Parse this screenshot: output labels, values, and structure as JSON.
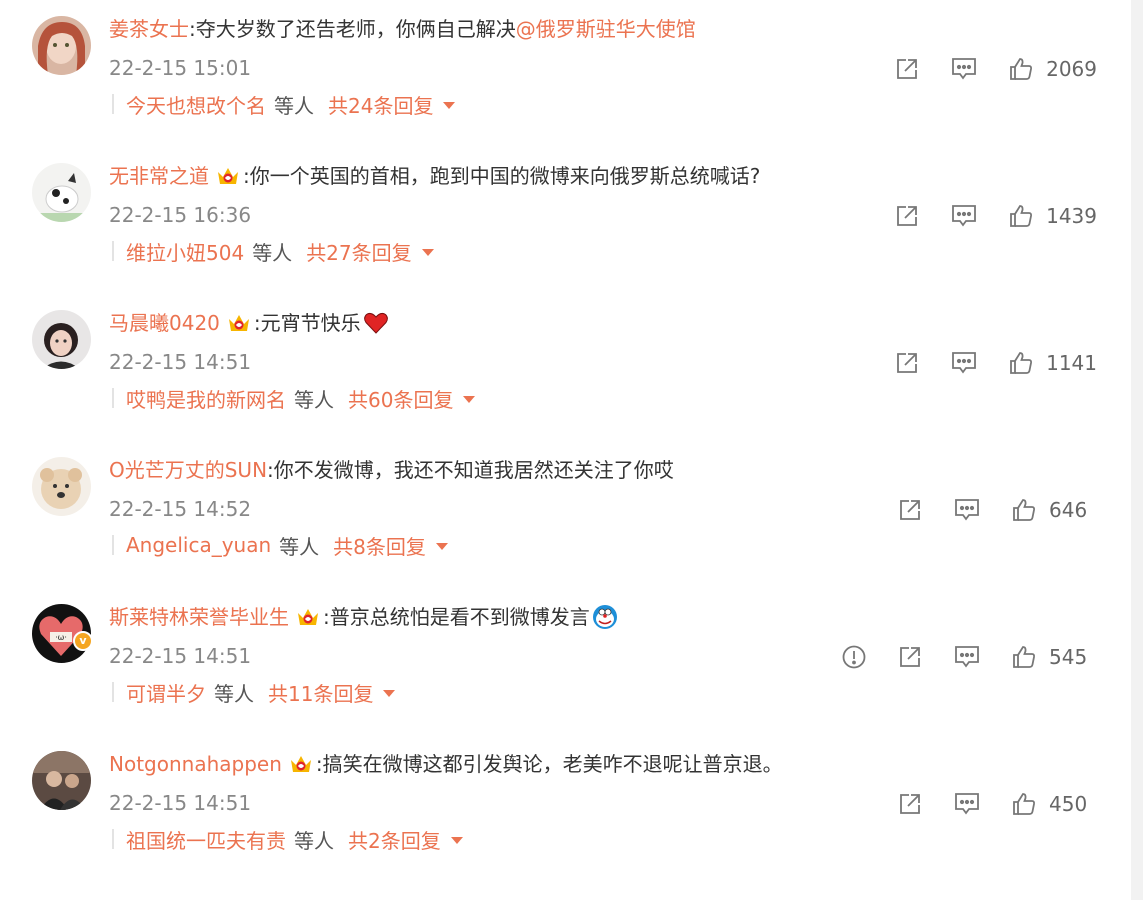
{
  "comments": [
    {
      "username": "姜茶女士",
      "has_crown": false,
      "text": "夺大岁数了还告老师，你俩自己解决",
      "mention": "@俄罗斯驻华大使馆",
      "time": "22-2-15 15:01",
      "likes": "2069",
      "reply_user": "今天也想改个名",
      "reply_mid": "等人",
      "reply_count": "共24条回复"
    },
    {
      "username": "无非常之道",
      "has_crown": true,
      "text": "你一个英国的首相，跑到中国的微博来向俄罗斯总统喊话?",
      "time": "22-2-15 16:36",
      "likes": "1439",
      "reply_user": "维拉小妞504",
      "reply_mid": "等人",
      "reply_count": "共27条回复"
    },
    {
      "username": "马晨曦0420",
      "has_crown": true,
      "text": "元宵节快乐",
      "emoji": "red-heart-emoji",
      "time": "22-2-15 14:51",
      "likes": "1141",
      "reply_user": "哎鸭是我的新网名",
      "reply_mid": "等人",
      "reply_count": "共60条回复"
    },
    {
      "username": "O光芒万丈的SUN",
      "has_crown": false,
      "text": "你不发微博，我还不知道我居然还关注了你哎",
      "time": "22-2-15 14:52",
      "likes": "646",
      "reply_user": "Angelica_yuan",
      "reply_mid": "等人",
      "reply_count": "共8条回复"
    },
    {
      "username": "斯莱特林荣誉毕业生",
      "has_crown": true,
      "verified": true,
      "text": "普京总统怕是看不到微博发言",
      "emoji": "doraemon-emoji",
      "time": "22-2-15 14:51",
      "likes": "545",
      "has_report": true,
      "reply_user": "可谓半夕",
      "reply_mid": "等人",
      "reply_count": "共11条回复"
    },
    {
      "username": "Notgonnahappen",
      "has_crown": true,
      "text": "搞笑在微博这都引发舆论，老美咋不退呢让普京退。",
      "time": "22-2-15 14:51",
      "likes": "450",
      "reply_user": "祖国统一匹夫有责",
      "reply_mid": "等人",
      "reply_count": "共2条回复"
    }
  ],
  "colors": {
    "link": "#eb7350",
    "text": "#333333",
    "meta": "#888888",
    "icon": "#777777"
  },
  "icons": {
    "share": "share-icon",
    "comment": "comment-icon",
    "like": "thumbs-up-icon",
    "report": "report-icon",
    "crown": "vip-crown-icon"
  }
}
